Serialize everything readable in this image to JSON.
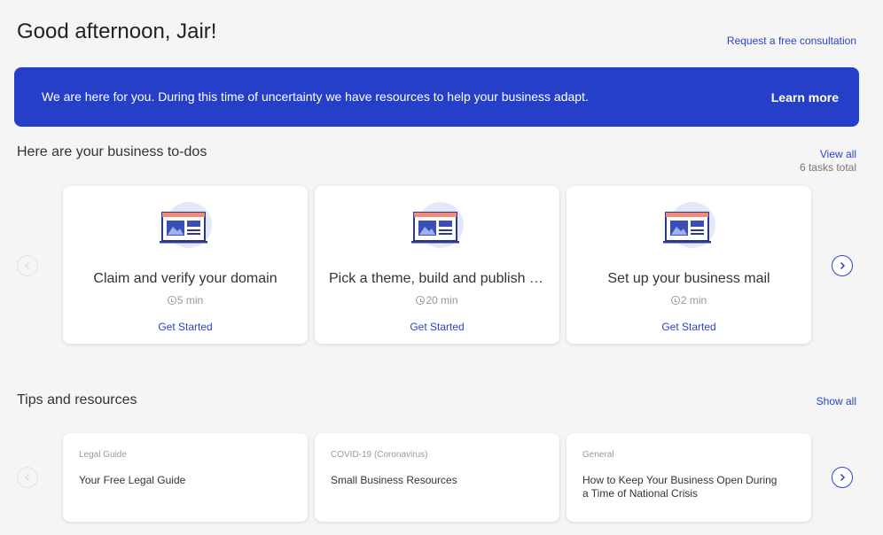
{
  "header": {
    "greeting": "Good afternoon, Jair!",
    "consult_link": "Request a free consultation"
  },
  "banner": {
    "text": "We are here for you. During this time of uncertainty we have resources to help your business adapt.",
    "action": "Learn more",
    "color": "#263fc9"
  },
  "todos": {
    "title": "Here are your business to-dos",
    "view_all": "View all",
    "total": "6 tasks total",
    "items": [
      {
        "title": "Claim and verify your domain",
        "time": "5 min",
        "action": "Get Started",
        "icon": "browser-illustration-icon"
      },
      {
        "title": "Pick a theme, build and publish your website",
        "time": "20 min",
        "action": "Get Started",
        "icon": "browser-illustration-icon"
      },
      {
        "title": "Set up your business mail",
        "time": "2 min",
        "action": "Get Started",
        "icon": "browser-illustration-icon"
      }
    ]
  },
  "tips": {
    "title": "Tips and resources",
    "show_all": "Show all",
    "items": [
      {
        "category": "Legal Guide",
        "title": "Your Free Legal Guide"
      },
      {
        "category": "COVID-19 (Coronavirus)",
        "title": "Small Business Resources"
      },
      {
        "category": "General",
        "title": "How to Keep Your Business Open During a Time of National Crisis"
      }
    ]
  },
  "colors": {
    "accent": "#2a44c9",
    "background": "#f5f5f6"
  },
  "icons": {
    "prev": "chevron-left-icon",
    "next": "chevron-right-icon",
    "clock": "clock-icon"
  }
}
